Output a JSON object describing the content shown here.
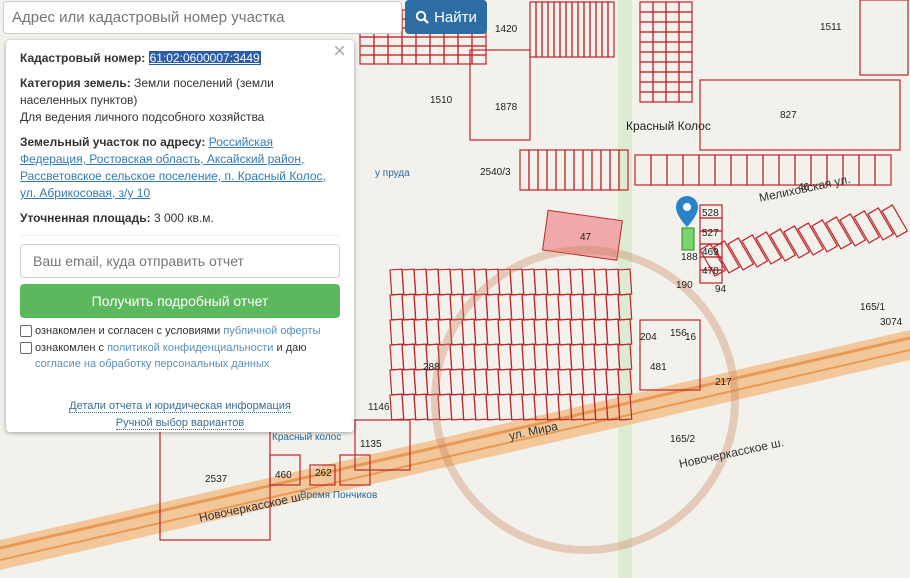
{
  "search": {
    "placeholder": "Адрес или кадастровый номер участка",
    "button": "Найти"
  },
  "panel": {
    "cad_label": "Кадастровый номер:",
    "cad_value": "61:02:0600007:3449",
    "cat_label": "Категория земель:",
    "cat_value": "Земли поселений (земли населенных пунктов)",
    "use": "Для ведения личного подсобного хозяйства",
    "addr_label": "Земельный участок по адресу:",
    "addr_value": "Российская Федерация, Ростовская область, Аксайский район, Рассветовское сельское поселение, п. Красный Колос, ул. Абрикосовая, з/у 10",
    "area_label": "Уточненная площадь:",
    "area_value": "3 000 кв.м.",
    "email_placeholder": "Ваш email, куда отправить отчет",
    "get_report": "Получить подробный отчет",
    "cb1_text": "ознакомлен и согласен с условиями ",
    "cb1_link": "публичной оферты",
    "cb2_text": "ознакомлен с ",
    "cb2_link": "политикой конфиденциальности",
    "cb2_mid": " и даю ",
    "cb2_link2": "согласие на обработку персональных данных",
    "details": "Детали отчета и юридическая информация",
    "manual": "Ручной выбор вариантов"
  },
  "map": {
    "labels": [
      {
        "t": "1420",
        "c": "p"
      },
      {
        "t": "1511",
        "c": "p"
      },
      {
        "t": "1510",
        "c": "p"
      },
      {
        "t": "1878",
        "c": "p"
      },
      {
        "t": "827",
        "c": "p"
      },
      {
        "t": "Красный Колос",
        "c": "place"
      },
      {
        "t": "у пруда",
        "c": "poi"
      },
      {
        "t": "2540/3",
        "c": "p"
      },
      {
        "t": "47",
        "c": "p"
      },
      {
        "t": "Мелиховская ул.",
        "c": "street"
      },
      {
        "t": "528",
        "c": "p"
      },
      {
        "t": "527",
        "c": "p"
      },
      {
        "t": "469",
        "c": "p"
      },
      {
        "t": "470",
        "c": "p"
      },
      {
        "t": "188",
        "c": "p"
      },
      {
        "t": "190",
        "c": "p"
      },
      {
        "t": "94",
        "c": "p"
      },
      {
        "t": "46",
        "c": "p"
      },
      {
        "t": "165/1",
        "c": "p"
      },
      {
        "t": "3074",
        "c": "p"
      },
      {
        "t": "217",
        "c": "p"
      },
      {
        "t": "165/2",
        "c": "p"
      },
      {
        "t": "Новочеркасское ш.",
        "c": "street"
      },
      {
        "t": "1135",
        "c": "p"
      },
      {
        "t": "460",
        "c": "p"
      },
      {
        "t": "262",
        "c": "p"
      },
      {
        "t": "2537",
        "c": "p"
      },
      {
        "t": "Красный колос",
        "c": "poi"
      },
      {
        "t": "Время Пончиков",
        "c": "poi"
      },
      {
        "t": "1146",
        "c": "p"
      },
      {
        "t": "288",
        "c": "p"
      },
      {
        "t": "204",
        "c": "p"
      },
      {
        "t": "481",
        "c": "p"
      },
      {
        "t": "ул. Мира",
        "c": "street"
      },
      {
        "t": "16",
        "c": "p"
      },
      {
        "t": "156",
        "c": "p"
      },
      {
        "t": "Новочеркасское ш.",
        "c": "street"
      }
    ]
  },
  "colors": {
    "parcel": "#c0262b",
    "accent": "#2e6da4",
    "green": "#5cb85c"
  }
}
